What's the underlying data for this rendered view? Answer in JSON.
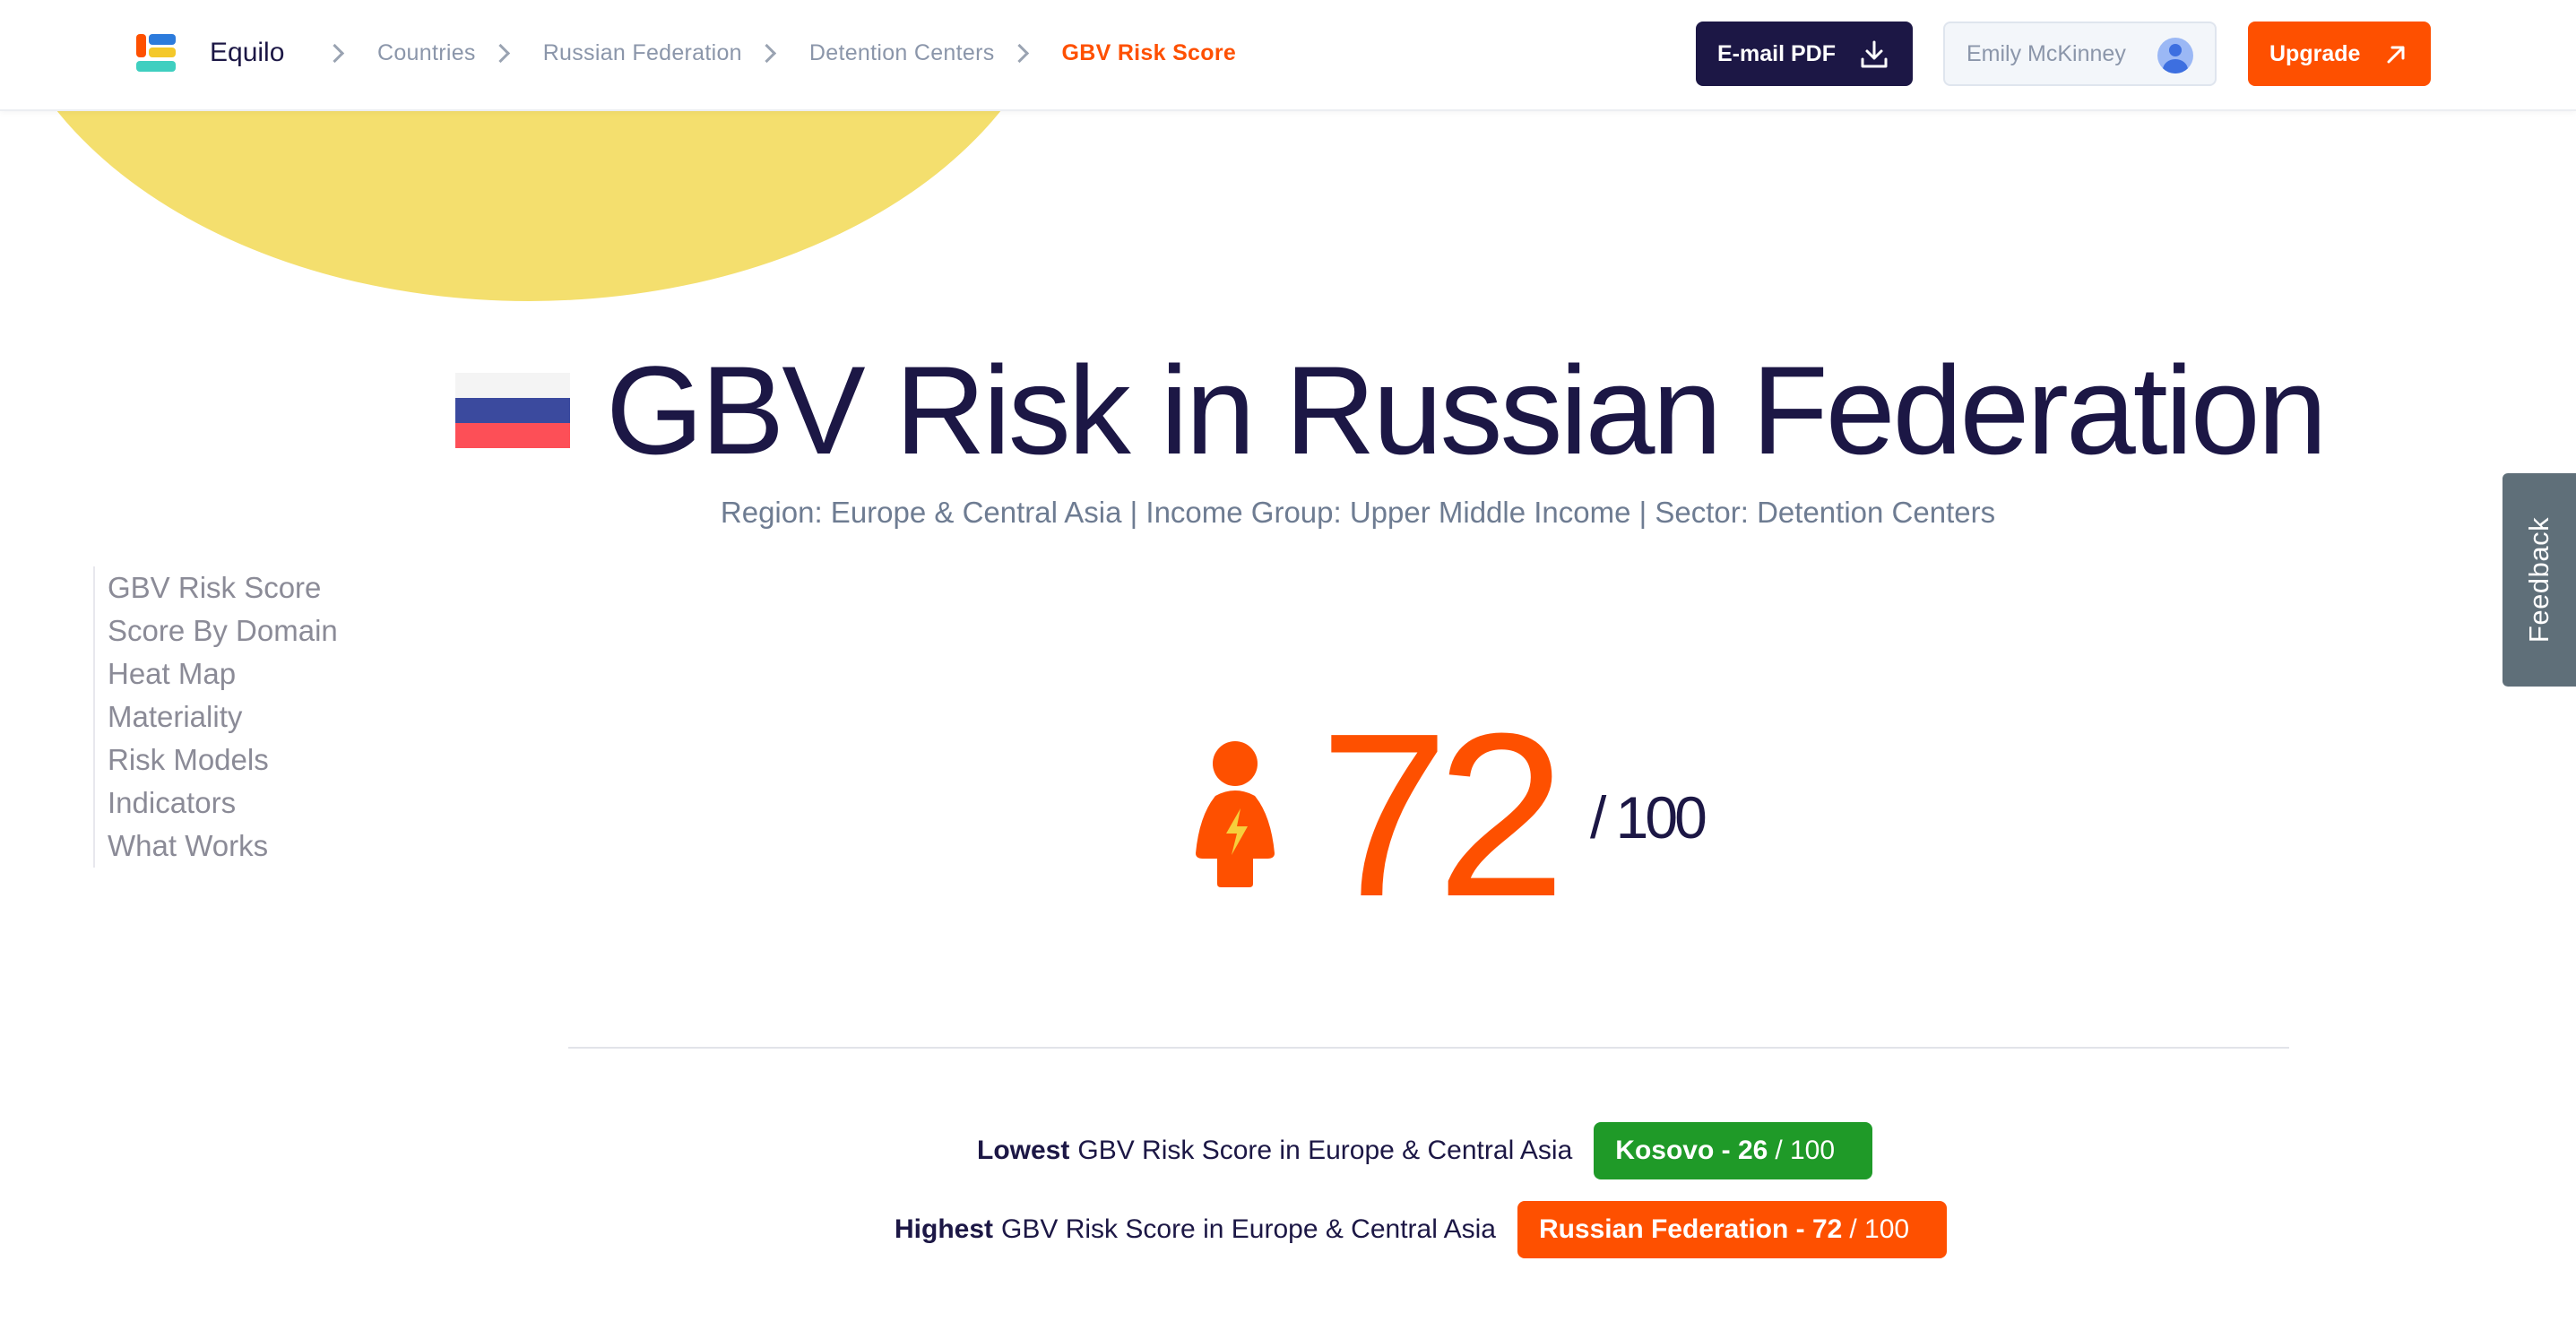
{
  "header": {
    "brand": "Equilo",
    "breadcrumbs": [
      "Countries",
      "Russian Federation",
      "Detention Centers",
      "GBV Risk Score"
    ],
    "email_pdf_label": "E-mail PDF",
    "user_name": "Emily McKinney",
    "upgrade_label": "Upgrade"
  },
  "main": {
    "title": "GBV Risk in Russian Federation",
    "subtitle": "Region: Europe & Central Asia | Income Group: Upper Middle Income | Sector: Detention Centers",
    "score": "72",
    "score_max": "/ 100",
    "lowest": {
      "prefix": "Lowest",
      "text": "GBV Risk Score in Europe & Central Asia",
      "country": "Kosovo - 26",
      "value": "/ 100"
    },
    "highest": {
      "prefix": "Highest",
      "text": "GBV Risk Score in Europe & Central Asia",
      "country": "Russian Federation - 72",
      "value": "/ 100"
    }
  },
  "sidebar": {
    "items": [
      {
        "label": "GBV Risk Score"
      },
      {
        "label": "Score By Domain"
      },
      {
        "label": "Heat Map"
      },
      {
        "label": "Materiality"
      },
      {
        "label": "Risk Models"
      },
      {
        "label": "Indicators"
      },
      {
        "label": "What Works"
      }
    ]
  },
  "feedback_label": "Feedback",
  "icons": {
    "logo": "equilo-logo-icon",
    "download": "download-icon",
    "avatar": "user-avatar-icon",
    "external": "arrow-up-right-icon",
    "person": "person-lightning-icon",
    "flag": "russia-flag-icon"
  },
  "colors": {
    "accent": "#fe5000",
    "navy": "#1c1745",
    "low": "#1f9a28",
    "deco": "#f4df6e"
  }
}
